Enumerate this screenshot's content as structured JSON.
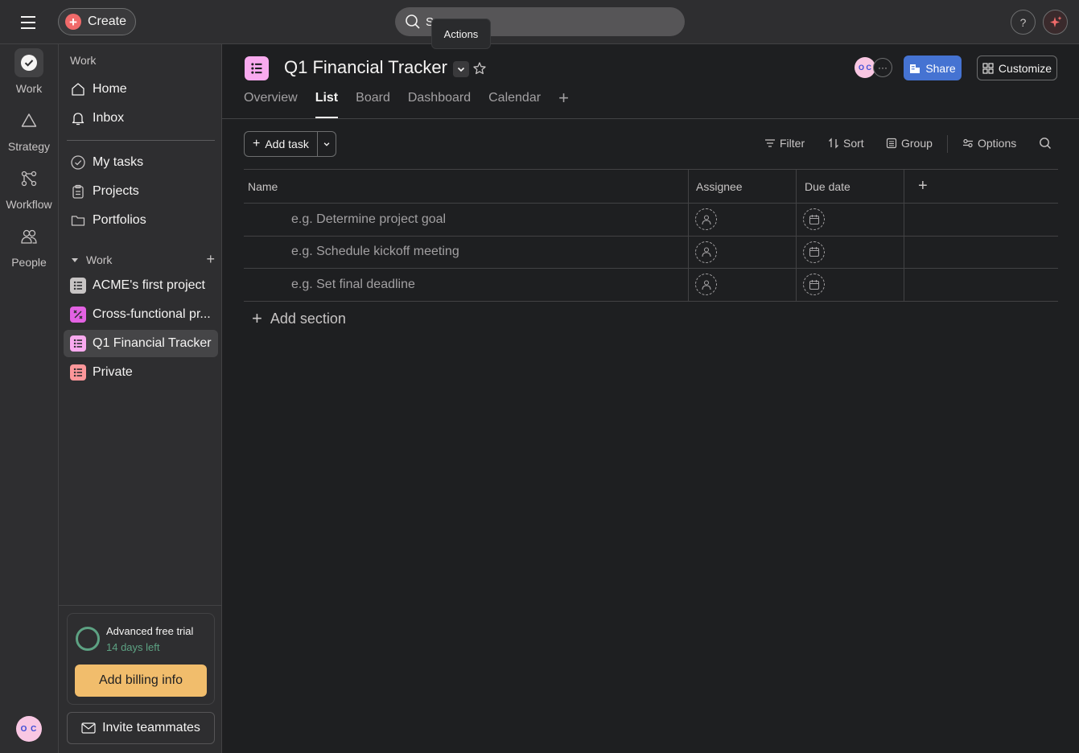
{
  "topbar": {
    "create_label": "Create",
    "search_placeholder": "S",
    "tooltip": "Actions",
    "help_label": "?"
  },
  "rail": {
    "items": [
      {
        "label": "Work",
        "icon": "check-circle-icon"
      },
      {
        "label": "Strategy",
        "icon": "triangle-icon"
      },
      {
        "label": "Workflow",
        "icon": "workflow-icon"
      },
      {
        "label": "People",
        "icon": "people-icon"
      }
    ],
    "avatar_text": "O C"
  },
  "sidebar": {
    "heading": "Work",
    "nav": [
      {
        "label": "Home",
        "icon": "home-icon"
      },
      {
        "label": "Inbox",
        "icon": "bell-icon"
      }
    ],
    "personal": [
      {
        "label": "My tasks",
        "icon": "check-circle-icon"
      },
      {
        "label": "Projects",
        "icon": "clipboard-icon"
      },
      {
        "label": "Portfolios",
        "icon": "folder-icon"
      }
    ],
    "section_label": "Work",
    "projects": [
      {
        "label": "ACME's first project",
        "color": "#c7c4c4"
      },
      {
        "label": "Cross-functional pr...",
        "color": "#e362e3"
      },
      {
        "label": "Q1 Financial Tracker",
        "color": "#f9aaef"
      },
      {
        "label": "Private",
        "color": "#fc979a"
      }
    ],
    "trial": {
      "title": "Advanced free trial",
      "subtitle": "14 days left",
      "billing_label": "Add billing info"
    },
    "invite_label": "Invite teammates"
  },
  "project": {
    "title": "Q1 Financial Tracker",
    "member_avatar_text": "O C",
    "member_more": "···",
    "share_label": "Share",
    "customize_label": "Customize",
    "tabs": [
      "Overview",
      "List",
      "Board",
      "Dashboard",
      "Calendar"
    ],
    "active_tab": "List"
  },
  "toolbar": {
    "add_task_label": "Add task",
    "filter_label": "Filter",
    "sort_label": "Sort",
    "group_label": "Group",
    "options_label": "Options"
  },
  "table": {
    "columns": [
      "Name",
      "Assignee",
      "Due date"
    ],
    "rows": [
      "e.g. Determine project goal",
      "e.g. Schedule kickoff meeting",
      "e.g. Set final deadline"
    ],
    "add_section_label": "Add section"
  },
  "colors": {
    "accent": "#4573d2",
    "create": "#f06a6a",
    "billing": "#f1bd6c",
    "trial_ring": "#5da283"
  }
}
